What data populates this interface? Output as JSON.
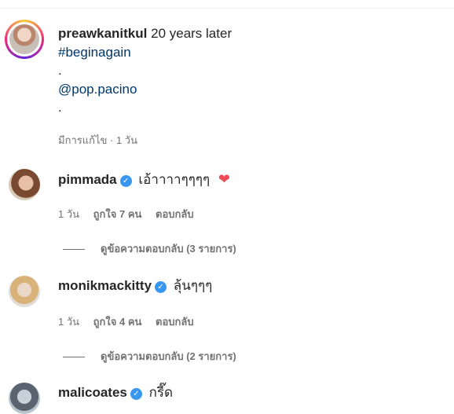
{
  "post": {
    "username": "preawkanitkul",
    "caption_text": "20 years later",
    "hashtag": "#beginagain",
    "dot1": ".",
    "mention": "@pop.pacino",
    "dot2": ".",
    "meta": "มีการแก้ไข · 1 วัน"
  },
  "comments": [
    {
      "username": "pimmada",
      "text": "เอ้าาาาๆๆๆๆ",
      "has_heart": true,
      "time": "1 วัน",
      "likes": "ถูกใจ 7 คน",
      "reply": "ตอบกลับ",
      "view_replies": "ดูข้อความตอบกลับ (3 รายการ)"
    },
    {
      "username": "monikmackitty",
      "text": "ลุ้นๆๆๆ",
      "time": "1 วัน",
      "likes": "ถูกใจ 4 คน",
      "reply": "ตอบกลับ",
      "view_replies": "ดูข้อความตอบกลับ (2 รายการ)"
    },
    {
      "username": "malicoates",
      "text": "กรี๊ด"
    }
  ],
  "icons": {
    "verified": "verified-badge-icon",
    "heart": "red-heart-emoji"
  }
}
